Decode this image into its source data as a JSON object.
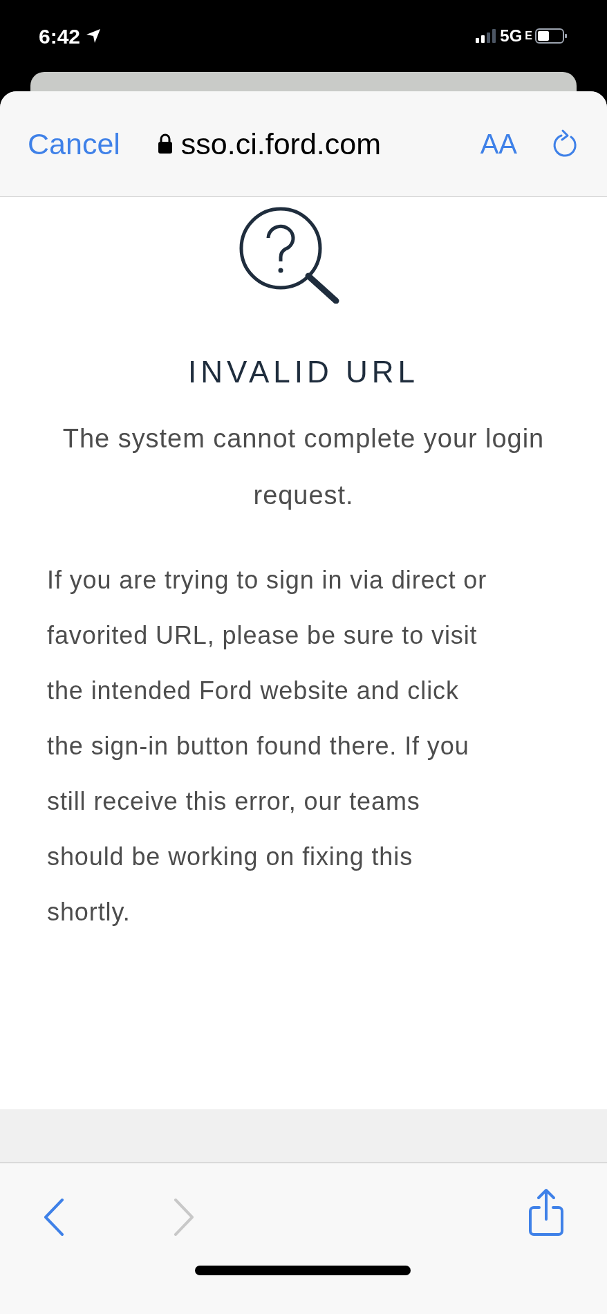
{
  "status_bar": {
    "time": "6:42",
    "network": "5G",
    "network_suffix": "E"
  },
  "browser_bar": {
    "cancel": "Cancel",
    "url": "sso.ci.ford.com",
    "text_size": "AA"
  },
  "page": {
    "title": "INVALID URL",
    "message": "The system cannot complete your login request.",
    "details": "If you are trying to sign in via direct or favorited URL, please be sure to visit the intended Ford website and click the sign-in button found there. If you still receive this error, our teams should be working on fixing this shortly."
  },
  "toolbar": {
    "back_disabled": false,
    "forward_disabled": true
  }
}
